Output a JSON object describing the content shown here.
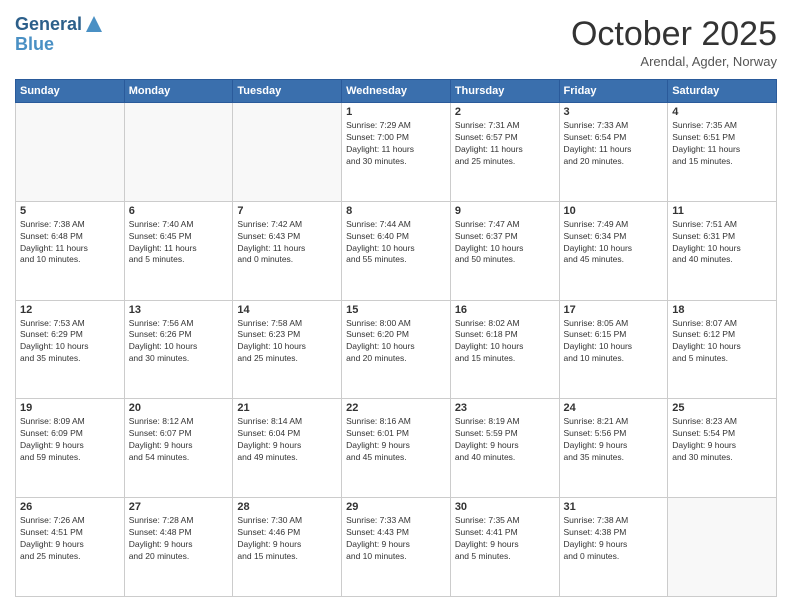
{
  "logo": {
    "line1": "General",
    "line2": "Blue"
  },
  "header": {
    "month": "October 2025",
    "location": "Arendal, Agder, Norway"
  },
  "weekdays": [
    "Sunday",
    "Monday",
    "Tuesday",
    "Wednesday",
    "Thursday",
    "Friday",
    "Saturday"
  ],
  "weeks": [
    [
      {
        "day": "",
        "info": ""
      },
      {
        "day": "",
        "info": ""
      },
      {
        "day": "",
        "info": ""
      },
      {
        "day": "1",
        "info": "Sunrise: 7:29 AM\nSunset: 7:00 PM\nDaylight: 11 hours\nand 30 minutes."
      },
      {
        "day": "2",
        "info": "Sunrise: 7:31 AM\nSunset: 6:57 PM\nDaylight: 11 hours\nand 25 minutes."
      },
      {
        "day": "3",
        "info": "Sunrise: 7:33 AM\nSunset: 6:54 PM\nDaylight: 11 hours\nand 20 minutes."
      },
      {
        "day": "4",
        "info": "Sunrise: 7:35 AM\nSunset: 6:51 PM\nDaylight: 11 hours\nand 15 minutes."
      }
    ],
    [
      {
        "day": "5",
        "info": "Sunrise: 7:38 AM\nSunset: 6:48 PM\nDaylight: 11 hours\nand 10 minutes."
      },
      {
        "day": "6",
        "info": "Sunrise: 7:40 AM\nSunset: 6:45 PM\nDaylight: 11 hours\nand 5 minutes."
      },
      {
        "day": "7",
        "info": "Sunrise: 7:42 AM\nSunset: 6:43 PM\nDaylight: 11 hours\nand 0 minutes."
      },
      {
        "day": "8",
        "info": "Sunrise: 7:44 AM\nSunset: 6:40 PM\nDaylight: 10 hours\nand 55 minutes."
      },
      {
        "day": "9",
        "info": "Sunrise: 7:47 AM\nSunset: 6:37 PM\nDaylight: 10 hours\nand 50 minutes."
      },
      {
        "day": "10",
        "info": "Sunrise: 7:49 AM\nSunset: 6:34 PM\nDaylight: 10 hours\nand 45 minutes."
      },
      {
        "day": "11",
        "info": "Sunrise: 7:51 AM\nSunset: 6:31 PM\nDaylight: 10 hours\nand 40 minutes."
      }
    ],
    [
      {
        "day": "12",
        "info": "Sunrise: 7:53 AM\nSunset: 6:29 PM\nDaylight: 10 hours\nand 35 minutes."
      },
      {
        "day": "13",
        "info": "Sunrise: 7:56 AM\nSunset: 6:26 PM\nDaylight: 10 hours\nand 30 minutes."
      },
      {
        "day": "14",
        "info": "Sunrise: 7:58 AM\nSunset: 6:23 PM\nDaylight: 10 hours\nand 25 minutes."
      },
      {
        "day": "15",
        "info": "Sunrise: 8:00 AM\nSunset: 6:20 PM\nDaylight: 10 hours\nand 20 minutes."
      },
      {
        "day": "16",
        "info": "Sunrise: 8:02 AM\nSunset: 6:18 PM\nDaylight: 10 hours\nand 15 minutes."
      },
      {
        "day": "17",
        "info": "Sunrise: 8:05 AM\nSunset: 6:15 PM\nDaylight: 10 hours\nand 10 minutes."
      },
      {
        "day": "18",
        "info": "Sunrise: 8:07 AM\nSunset: 6:12 PM\nDaylight: 10 hours\nand 5 minutes."
      }
    ],
    [
      {
        "day": "19",
        "info": "Sunrise: 8:09 AM\nSunset: 6:09 PM\nDaylight: 9 hours\nand 59 minutes."
      },
      {
        "day": "20",
        "info": "Sunrise: 8:12 AM\nSunset: 6:07 PM\nDaylight: 9 hours\nand 54 minutes."
      },
      {
        "day": "21",
        "info": "Sunrise: 8:14 AM\nSunset: 6:04 PM\nDaylight: 9 hours\nand 49 minutes."
      },
      {
        "day": "22",
        "info": "Sunrise: 8:16 AM\nSunset: 6:01 PM\nDaylight: 9 hours\nand 45 minutes."
      },
      {
        "day": "23",
        "info": "Sunrise: 8:19 AM\nSunset: 5:59 PM\nDaylight: 9 hours\nand 40 minutes."
      },
      {
        "day": "24",
        "info": "Sunrise: 8:21 AM\nSunset: 5:56 PM\nDaylight: 9 hours\nand 35 minutes."
      },
      {
        "day": "25",
        "info": "Sunrise: 8:23 AM\nSunset: 5:54 PM\nDaylight: 9 hours\nand 30 minutes."
      }
    ],
    [
      {
        "day": "26",
        "info": "Sunrise: 7:26 AM\nSunset: 4:51 PM\nDaylight: 9 hours\nand 25 minutes."
      },
      {
        "day": "27",
        "info": "Sunrise: 7:28 AM\nSunset: 4:48 PM\nDaylight: 9 hours\nand 20 minutes."
      },
      {
        "day": "28",
        "info": "Sunrise: 7:30 AM\nSunset: 4:46 PM\nDaylight: 9 hours\nand 15 minutes."
      },
      {
        "day": "29",
        "info": "Sunrise: 7:33 AM\nSunset: 4:43 PM\nDaylight: 9 hours\nand 10 minutes."
      },
      {
        "day": "30",
        "info": "Sunrise: 7:35 AM\nSunset: 4:41 PM\nDaylight: 9 hours\nand 5 minutes."
      },
      {
        "day": "31",
        "info": "Sunrise: 7:38 AM\nSunset: 4:38 PM\nDaylight: 9 hours\nand 0 minutes."
      },
      {
        "day": "",
        "info": ""
      }
    ]
  ]
}
